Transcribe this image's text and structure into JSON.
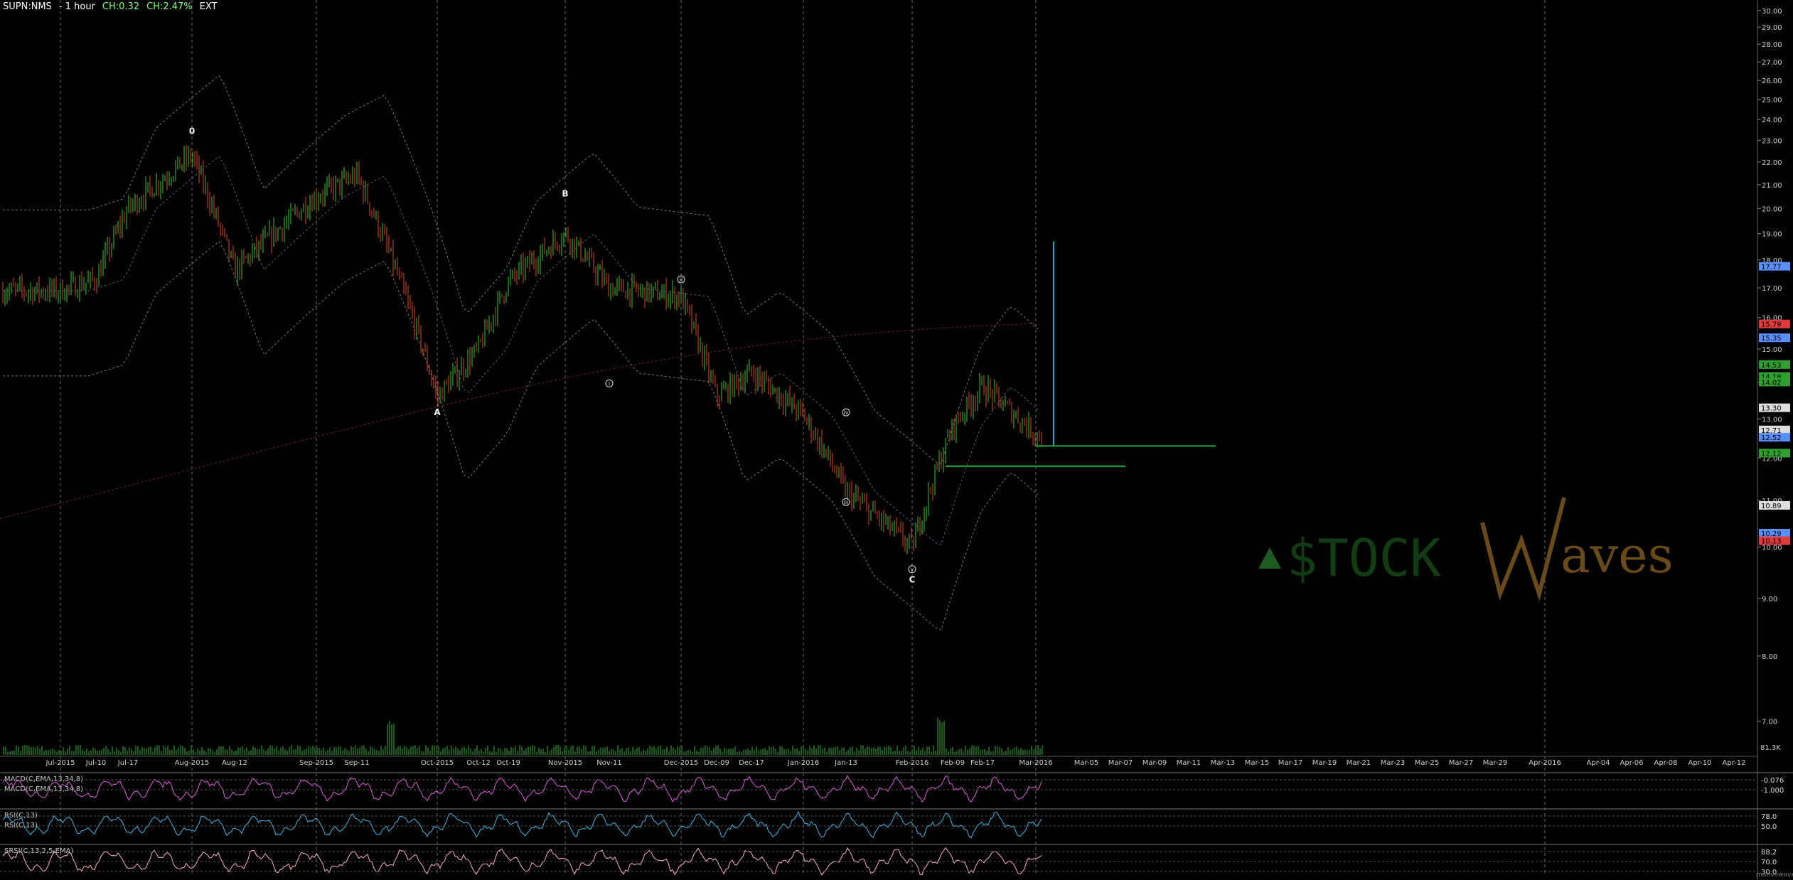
{
  "header": {
    "symbol": "SUPN:NMS",
    "interval": "- 1 hour",
    "ch": "CH:0.32",
    "ch_pct": "CH:2.47%",
    "ext": "EXT"
  },
  "watermark": {
    "text": "$TOCKWaves",
    "site": "motivewave.com"
  },
  "colors": {
    "background": "#000000",
    "grid": "#9a9a9a",
    "bull_candle": "#2fd12f",
    "bear_candle": "#e0471f",
    "target_line": "#1fa7c7",
    "support_line": "#1fae3a",
    "macd": "#e05ce0",
    "rsi": "#3fb6e8",
    "stoch": "#ffb4c0"
  },
  "chart_data": {
    "type": "candlestick",
    "y_axis_labels": [
      "30.00",
      "29.00",
      "28.00",
      "27.00",
      "26.00",
      "25.00",
      "24.00",
      "23.00",
      "22.00",
      "21.00",
      "20.00",
      "19.00",
      "18.00",
      "17.00",
      "16.00",
      "15.00",
      "14.00",
      "13.00",
      "12.00",
      "11.00",
      "10.00",
      "9.00",
      "8.00",
      "7.00"
    ],
    "ylim": [
      6.6,
      30.3
    ],
    "scale": "log",
    "x_axis_labels": [
      "Jul-2015",
      "Jul-10",
      "Jul-17",
      "Aug-2015",
      "Aug-12",
      "Sep-2015",
      "Sep-11",
      "Oct-2015",
      "Oct-12",
      "Oct-19",
      "Nov-2015",
      "Nov-11",
      "Dec-2015",
      "Dec-09",
      "Dec-17",
      "Jan-2016",
      "Jan-13",
      "Feb-2016",
      "Feb-09",
      "Feb-17",
      "Mar-2016",
      "Mar-05",
      "Mar-07",
      "Mar-09",
      "Mar-11",
      "Mar-13",
      "Mar-15",
      "Mar-17",
      "Mar-19",
      "Mar-21",
      "Mar-23",
      "Mar-25",
      "Mar-27",
      "Mar-29",
      "Apr-2016",
      "Apr-04",
      "Apr-06",
      "Apr-08",
      "Apr-10",
      "Apr-12"
    ],
    "price_series": [
      [
        "Jul-2015",
        16.9
      ],
      [
        "Jul-10",
        17.3
      ],
      [
        "Jul-17",
        20.0
      ],
      [
        "Aug-2015",
        22.3
      ],
      [
        "Aug-12",
        17.6
      ],
      [
        "Sep-2015",
        20.5
      ],
      [
        "Sep-11",
        21.4
      ],
      [
        "Oct-2015",
        13.6
      ],
      [
        "Oct-12",
        15.0
      ],
      [
        "Oct-19",
        17.2
      ],
      [
        "Nov-2015",
        19.0
      ],
      [
        "Nov-11",
        17.0
      ],
      [
        "Dec-2015",
        16.7
      ],
      [
        "Dec-09",
        13.6
      ],
      [
        "Dec-17",
        14.3
      ],
      [
        "Jan-2016",
        13.1
      ],
      [
        "Jan-13",
        11.2
      ],
      [
        "Feb-2016",
        10.0
      ],
      [
        "Feb-09",
        12.8
      ],
      [
        "Feb-17",
        13.9
      ],
      [
        "Mar-2016",
        12.6
      ]
    ],
    "wave_labels": [
      {
        "text": "0",
        "x": "Aug-2015",
        "y": 23.3
      },
      {
        "text": "A",
        "x": "Oct-2015",
        "y": 13.1
      },
      {
        "text": "B",
        "x": "Nov-2015",
        "y": 20.5
      },
      {
        "text": "i",
        "x": "Nov-11",
        "y": 13.9
      },
      {
        "text": "ii",
        "x": "Dec-2015",
        "y": 17.2
      },
      {
        "text": "iii",
        "x": "Jan-13",
        "y": 10.9
      },
      {
        "text": "iv",
        "x": "Jan-13",
        "y": 13.1
      },
      {
        "text": "v",
        "x": "Feb-2016",
        "y": 9.5
      },
      {
        "text": "C",
        "x": "Feb-2016",
        "y": 9.3
      }
    ],
    "price_tags": [
      {
        "text": "17.77",
        "value": 17.77,
        "color": "#5a8fff"
      },
      {
        "text": "15.79",
        "value": 15.79,
        "color": "#e03b3b"
      },
      {
        "text": "15.35",
        "value": 15.35,
        "color": "#5a8fff"
      },
      {
        "text": "14.53",
        "value": 14.53,
        "color": "#2fa02f"
      },
      {
        "text": "14.18",
        "value": 14.18,
        "color": "#2fa02f"
      },
      {
        "text": "14.02",
        "value": 14.02,
        "color": "#2fa02f"
      },
      {
        "text": "13.30",
        "value": 13.3,
        "color": "#dddddd"
      },
      {
        "text": "12.71",
        "value": 12.71,
        "color": "#dddddd"
      },
      {
        "text": "12.52",
        "value": 12.52,
        "color": "#5a8fff"
      },
      {
        "text": "12.12",
        "value": 12.12,
        "color": "#2fa02f"
      },
      {
        "text": "10.89",
        "value": 10.89,
        "color": "#dddddd"
      },
      {
        "text": "10.29",
        "value": 10.29,
        "color": "#5a8fff"
      },
      {
        "text": "10.13",
        "value": 10.13,
        "color": "#e03b3b"
      }
    ],
    "target_projection": {
      "from_date": "Mar-2016",
      "top": 18.7,
      "bottom": 12.3
    },
    "support_levels": [
      12.3,
      11.8
    ],
    "volume_label": "81.3K"
  },
  "indicators": {
    "macd": {
      "label": "MACD(C,EMA,13,34,8)",
      "label2": "MACD(C,EMA,13,34,8)",
      "tags": [
        "-0.076",
        "-1.000"
      ]
    },
    "rsi": {
      "label": "RSI(C,13)",
      "label2": "RSI(C,13)",
      "tags": [
        "78.0",
        "50.0"
      ]
    },
    "stoch": {
      "label": "SRSI(C,13,2,5,EMA)",
      "tags": [
        "88.2",
        "70.0",
        "30.0"
      ]
    }
  }
}
